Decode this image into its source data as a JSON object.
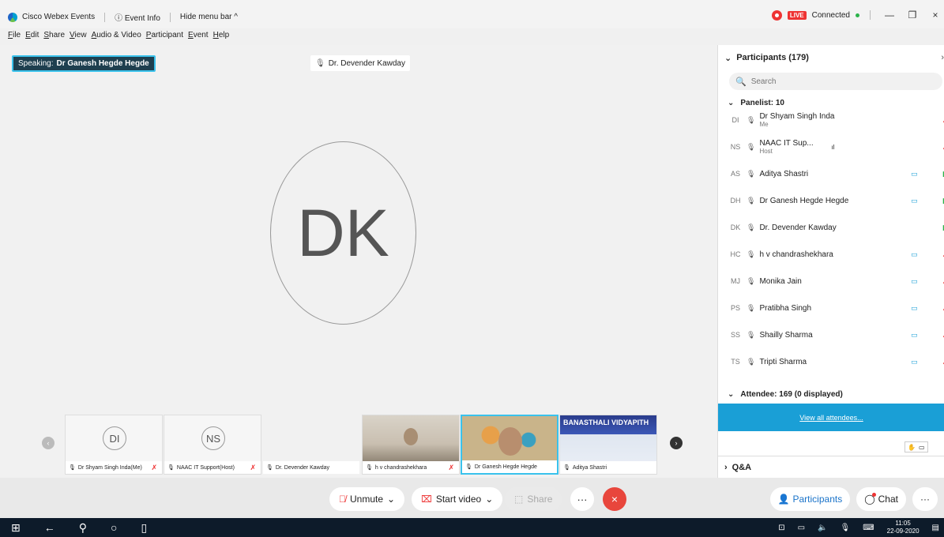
{
  "titlebar": {
    "app_name": "Cisco Webex Events",
    "event_info": "Event Info",
    "hide_menu": "Hide menu bar",
    "live": "LIVE",
    "status": "Connected",
    "minimize": "—",
    "maximize": "❐",
    "close": "×"
  },
  "menu": [
    "File",
    "Edit",
    "Share",
    "View",
    "Audio & Video",
    "Participant",
    "Event",
    "Help"
  ],
  "stage": {
    "speaking_prefix": "Speaking:",
    "speaking_name": "Dr Ganesh Hegde Hegde",
    "active_name": "Dr. Devender Kawday",
    "active_initials": "DK"
  },
  "filmstrip": [
    {
      "initials": "DI",
      "label": "Dr Shyam Singh Inda(Me)",
      "muted": true
    },
    {
      "initials": "NS",
      "label": "NAAC IT Support(Host)",
      "muted": true
    },
    {
      "initials": "",
      "label": "Dr. Devender Kawday",
      "muted": false
    },
    {
      "initials": "",
      "label": "h v chandrashekhara",
      "muted": true
    },
    {
      "initials": "",
      "label": "Dr Ganesh Hegde Hegde",
      "muted": false
    },
    {
      "initials": "",
      "label": "Aditya Shastri",
      "muted": false,
      "banner": "BANASTHALI VIDYAPITH"
    }
  ],
  "toolbar": {
    "unmute": "Unmute",
    "start_video": "Start video",
    "share": "Share",
    "more": "···",
    "end": "×",
    "participants": "Participants",
    "chat": "Chat",
    "more_right": "···"
  },
  "panel": {
    "title": "Participants (179)",
    "search_placeholder": "Search",
    "panelist_head": "Panelist: 10",
    "attendee_head": "Attendee: 169 (0 displayed)",
    "view_all": "View all attendees...",
    "qa": "Q&A",
    "participants": [
      {
        "initials": "DI",
        "name": "Dr Shyam Singh Inda",
        "sub": "Me",
        "video": false,
        "mic": "muted"
      },
      {
        "initials": "NS",
        "name": "NAAC IT Sup...",
        "sub": "Host",
        "video": false,
        "mic": "muted",
        "signal": "   ıl"
      },
      {
        "initials": "AS",
        "name": "Aditya Shastri",
        "sub": "",
        "video": true,
        "mic": "on"
      },
      {
        "initials": "DH",
        "name": "Dr Ganesh Hegde Hegde",
        "sub": "",
        "video": true,
        "mic": "on"
      },
      {
        "initials": "DK",
        "name": "Dr. Devender Kawday",
        "sub": "",
        "video": false,
        "mic": "on"
      },
      {
        "initials": "HC",
        "name": "h v chandrashekhara",
        "sub": "",
        "video": true,
        "mic": "muted"
      },
      {
        "initials": "MJ",
        "name": "Monika Jain",
        "sub": "",
        "video": true,
        "mic": "muted"
      },
      {
        "initials": "PS",
        "name": "Pratibha Singh",
        "sub": "",
        "video": true,
        "mic": "muted"
      },
      {
        "initials": "SS",
        "name": "Shailly Sharma",
        "sub": "",
        "video": true,
        "mic": "muted"
      },
      {
        "initials": "TS",
        "name": "Tripti Sharma",
        "sub": "",
        "video": true,
        "mic": "muted"
      }
    ]
  },
  "taskbar": {
    "time": "11:05",
    "date": "22-09-2020"
  }
}
